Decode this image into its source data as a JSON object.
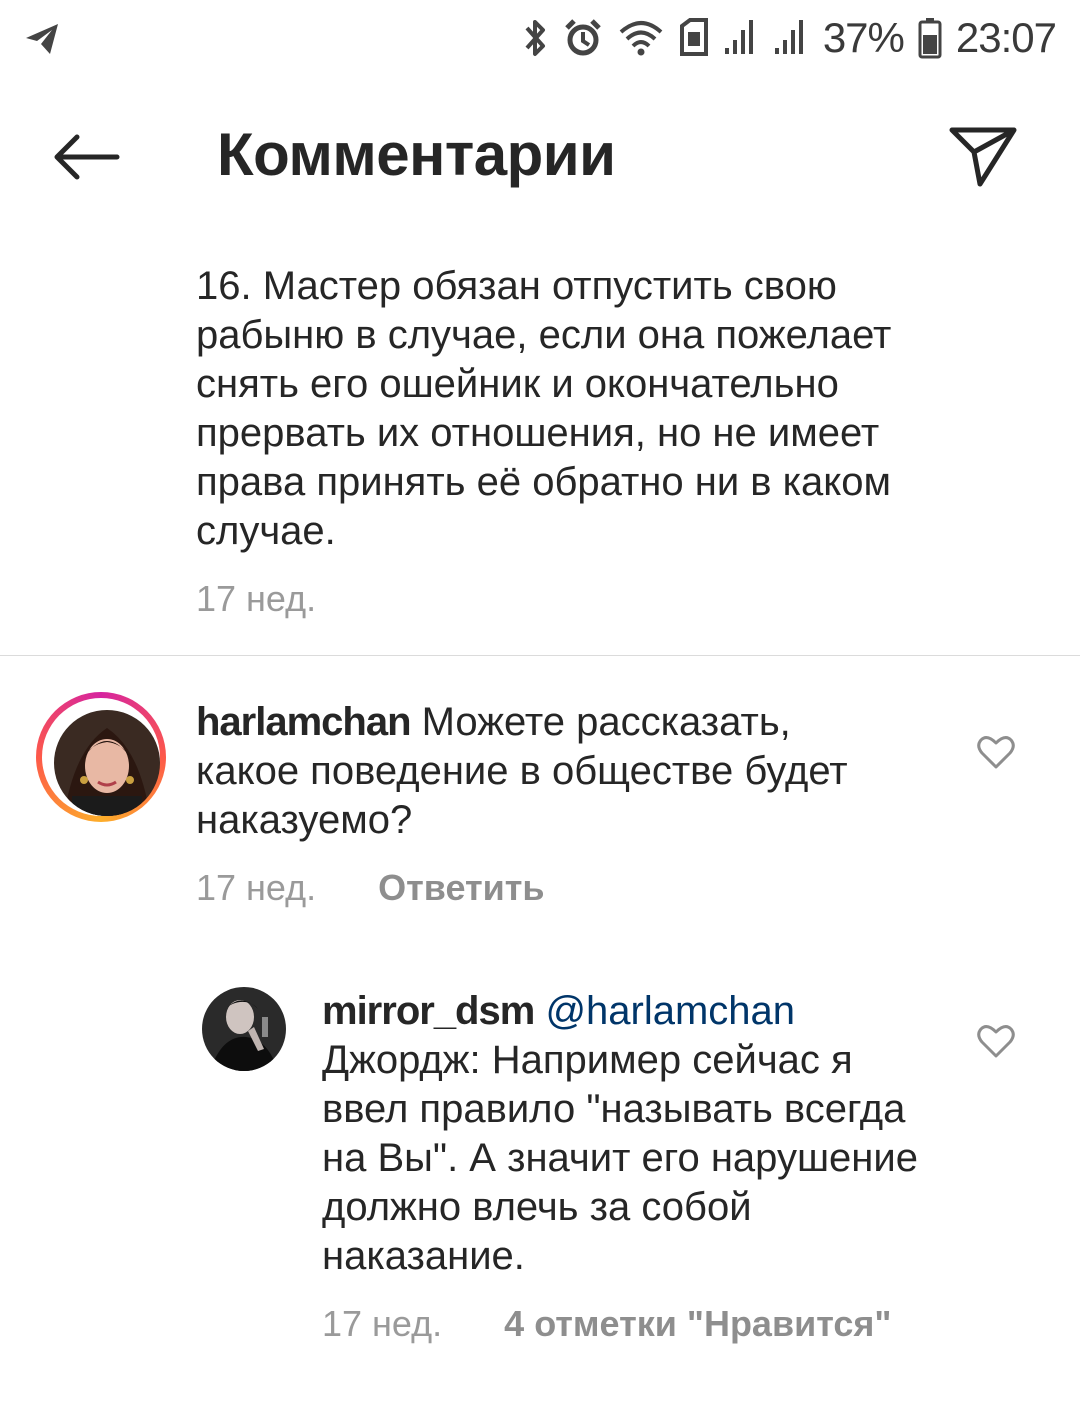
{
  "status_bar": {
    "battery": "37%",
    "time": "23:07",
    "icons": [
      "telegram-icon",
      "bluetooth-icon",
      "alarm-icon",
      "wifi-icon",
      "sim-icon",
      "signal-1-icon",
      "signal-2-icon",
      "battery-icon"
    ]
  },
  "header": {
    "title": "Комментарии",
    "back_icon": "arrow-left-icon",
    "share_icon": "paper-plane-icon"
  },
  "caption": {
    "text": "16. Мастер обязан отпустить свою рабыню в случае, если она пожелает снять его ошейник и окончательно прервать их отношения, но не имеет права принять её обратно ни в каком случае.",
    "time": "17 нед."
  },
  "comments": [
    {
      "username": "harlamchan",
      "text": "Можете рассказать, какое поведение в обществе будет наказуемо?",
      "time": "17 нед.",
      "reply_label": "Ответить"
    },
    {
      "username": "mirror_dsm",
      "mention": "@harlamchan",
      "text": "Джордж: Например сейчас я ввел правило \"называть всегда на Вы\". А значит его нарушение должно влечь за собой наказание.",
      "time": "17 нед.",
      "likes_label": "4 отметки \"Нравится\""
    }
  ],
  "colors": {
    "text": "#262626",
    "secondary": "#9a9a9a",
    "mention": "#003569",
    "divider": "#dbdbdb"
  }
}
